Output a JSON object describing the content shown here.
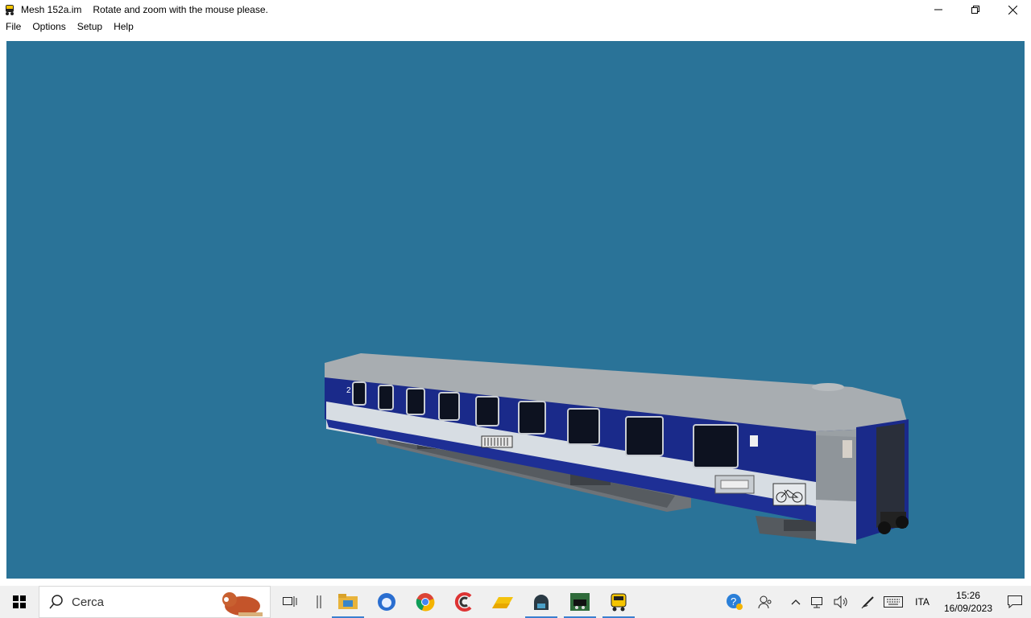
{
  "window": {
    "title": "Mesh 152a.im",
    "subtitle": "Rotate and zoom with the mouse please."
  },
  "menu": {
    "items": [
      "File",
      "Options",
      "Setup",
      "Help"
    ]
  },
  "viewport": {
    "background_color": "#2a7398",
    "model": "passenger-coach-3d-model"
  },
  "coach_markings": {
    "class_number": "2",
    "bicycle_symbol": "bicycle-icon"
  },
  "taskbar": {
    "search_placeholder": "Cerca",
    "apps": [
      "task-view-icon",
      "file-explorer-icon",
      "thunderbird-icon",
      "chrome-icon",
      "ccleaner-icon",
      "drive-icon",
      "app-icon",
      "train-sim-icon",
      "loco-icon"
    ],
    "tray": {
      "language": "ITA",
      "time": "15:26",
      "date": "16/09/2023"
    }
  },
  "colors": {
    "coach_blue": "#1a2a8a",
    "coach_white": "#d7dde3",
    "roof_gray": "#a8adb1",
    "taskbar_bg": "#f0f0f0"
  }
}
